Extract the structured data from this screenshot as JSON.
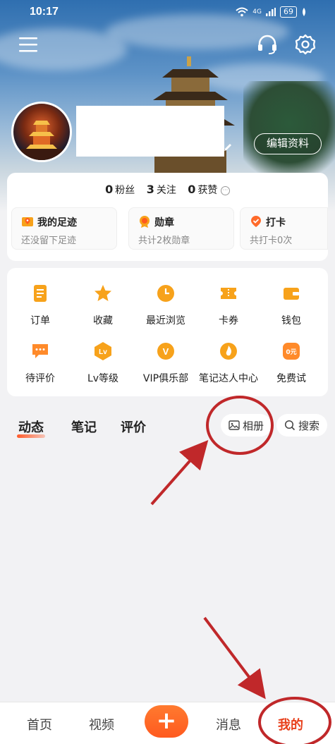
{
  "status_bar": {
    "time": "10:17",
    "network": "4G",
    "battery": "69"
  },
  "profile": {
    "edit_button": "编辑资料"
  },
  "stats": [
    {
      "value": "0",
      "label": "粉丝"
    },
    {
      "value": "3",
      "label": "关注"
    },
    {
      "value": "0",
      "label": "获赞"
    }
  ],
  "mini_cards": [
    {
      "title": "我的足迹",
      "subtitle": "还没留下足迹",
      "icon": "footprint-map-icon"
    },
    {
      "title": "勋章",
      "subtitle": "共计2枚勋章",
      "icon": "medal-icon"
    },
    {
      "title": "打卡",
      "subtitle": "共打卡0次",
      "icon": "checkin-pin-icon"
    }
  ],
  "grid": [
    {
      "label": "订单",
      "icon": "order-icon"
    },
    {
      "label": "收藏",
      "icon": "star-icon"
    },
    {
      "label": "最近浏览",
      "icon": "clock-icon"
    },
    {
      "label": "卡券",
      "icon": "coupon-icon"
    },
    {
      "label": "钱包",
      "icon": "wallet-icon"
    },
    {
      "label": "待评价",
      "icon": "comment-icon"
    },
    {
      "label": "Lv等级",
      "icon": "level-icon"
    },
    {
      "label": "VIP俱乐部",
      "icon": "vip-icon"
    },
    {
      "label": "笔记达人中心",
      "icon": "flame-icon"
    },
    {
      "label": "免费试",
      "icon": "free-trial-icon"
    }
  ],
  "grid_icon_texts": {
    "level": "Lv",
    "vip": "V",
    "free": "0元"
  },
  "tabs": [
    {
      "label": "动态",
      "active": true
    },
    {
      "label": "笔记",
      "active": false
    },
    {
      "label": "评价",
      "active": false
    }
  ],
  "album_button": "相册",
  "search_button": "搜索",
  "bottom_nav": {
    "home": "首页",
    "video": "视频",
    "plus": "+",
    "messages": "消息",
    "mine": "我的"
  },
  "colors": {
    "accent": "#ff5a1f",
    "annotation": "#c0282a",
    "icon_orange": "#f7a21b"
  }
}
